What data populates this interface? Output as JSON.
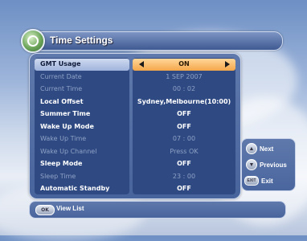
{
  "header": {
    "title": "Time Settings",
    "icon": "clock-settings-icon"
  },
  "settings": [
    {
      "label": "GMT Usage",
      "value": "ON",
      "state": "selected"
    },
    {
      "label": "Current Date",
      "value": "1  SEP  2007",
      "state": "disabled"
    },
    {
      "label": "Current Time",
      "value": "00 : 02",
      "state": "disabled"
    },
    {
      "label": "Local Offset",
      "value": "Sydney,Melbourne(10:00)",
      "state": "normal"
    },
    {
      "label": "Summer Time",
      "value": "OFF",
      "state": "normal"
    },
    {
      "label": "Wake Up Mode",
      "value": "OFF",
      "state": "normal"
    },
    {
      "label": "Wake Up Time",
      "value": "07 : 00",
      "state": "disabled"
    },
    {
      "label": "Wake Up Channel",
      "value": "Press OK",
      "state": "disabled"
    },
    {
      "label": "Sleep Mode",
      "value": "OFF",
      "state": "normal"
    },
    {
      "label": "Sleep Time",
      "value": "23 : 00",
      "state": "disabled"
    },
    {
      "label": "Automatic Standby",
      "value": "OFF",
      "state": "normal"
    }
  ],
  "side_buttons": {
    "next": {
      "label": "Next",
      "icon": "up-arrow-icon"
    },
    "previous": {
      "label": "Previous",
      "icon": "down-arrow-icon"
    },
    "exit": {
      "label": "Exit",
      "key": "EXIT"
    }
  },
  "footer": {
    "ok_key": "OK",
    "view_list": "View List"
  },
  "colors": {
    "selected_value_bg": "#f4a64a",
    "selected_label_bg": "#cfdaf0",
    "panel_bg": "#2f4a82"
  }
}
